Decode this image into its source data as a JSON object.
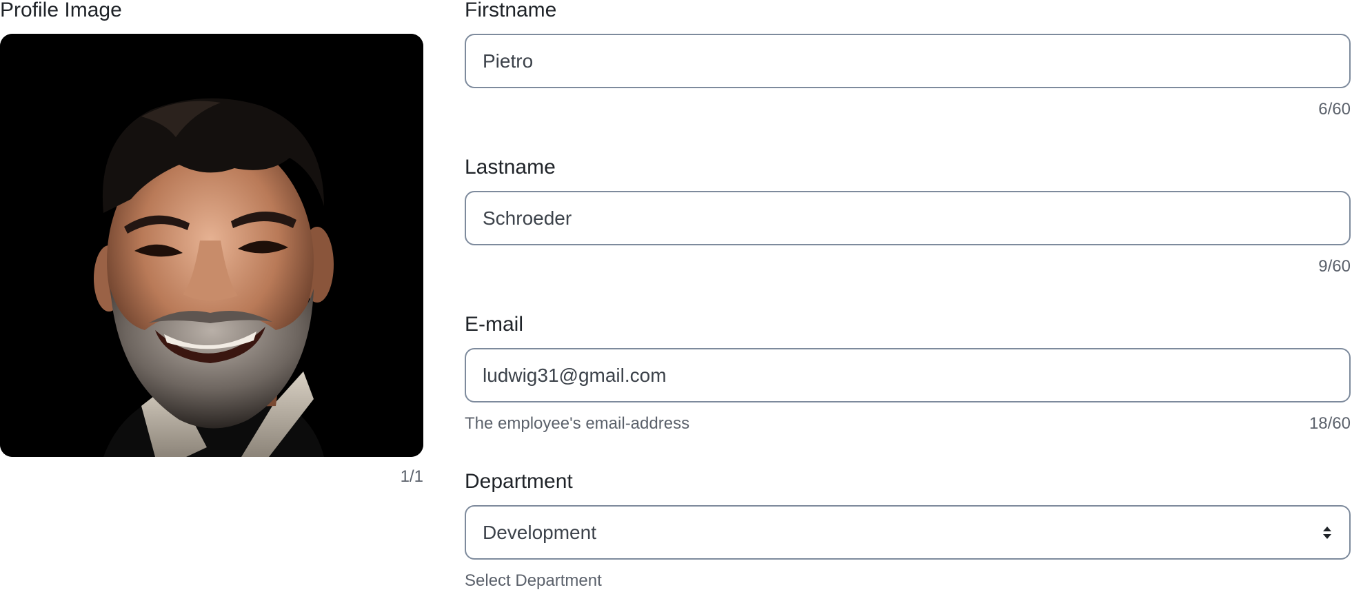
{
  "profile": {
    "label": "Profile Image",
    "image_counter": "1/1"
  },
  "form": {
    "firstname": {
      "label": "Firstname",
      "value": "Pietro",
      "counter": "6/60"
    },
    "lastname": {
      "label": "Lastname",
      "value": "Schroeder",
      "counter": "9/60"
    },
    "email": {
      "label": "E-mail",
      "value": "ludwig31@gmail.com",
      "helper": "The employee's email-address",
      "counter": "18/60"
    },
    "department": {
      "label": "Department",
      "selected": "Development",
      "helper": "Select Department",
      "icon": "sort-updown-icon"
    }
  },
  "colors": {
    "border": "#7d8a9c",
    "text": "#1f2328",
    "muted": "#5b616b",
    "photo_background": "#000000"
  }
}
